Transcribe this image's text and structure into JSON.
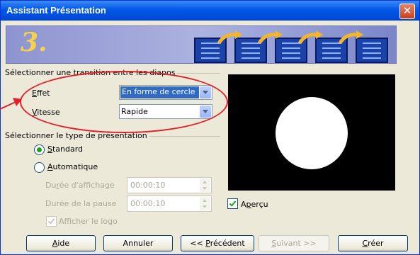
{
  "window": {
    "title": "Assistant Présentation",
    "close_glyph": "✕"
  },
  "banner": {
    "step_number": "3."
  },
  "transition_group": {
    "title": "Sélectionner une transition entre les diapos",
    "effect": {
      "label_first": "E",
      "label_rest": "ffet",
      "value": "En forme de cercle"
    },
    "speed": {
      "label_first": "V",
      "label_rest": "itesse",
      "value": "Rapide"
    }
  },
  "type_group": {
    "title": "Sélectionner le type de présentation",
    "standard": {
      "label_first": "S",
      "label_rest": "tandard",
      "selected": true
    },
    "automatic": {
      "label_first": "A",
      "label_rest": "utomatique",
      "selected": false
    },
    "display_duration": {
      "label_pre": "Du",
      "label_u": "r",
      "label_post": "ée d'affichage",
      "value": "00:00:10"
    },
    "pause_duration": {
      "label": "Durée de la pause",
      "value": "00:00:10"
    },
    "show_logo": {
      "label": "Afficher le logo",
      "checked": true
    }
  },
  "preview": {
    "label_first": "A",
    "label_u": "p",
    "label_rest": "erçu",
    "checked": true
  },
  "buttons": {
    "help": {
      "u": "A",
      "rest": "ide"
    },
    "cancel": "Annuler",
    "previous": {
      "pre": "<< ",
      "u": "P",
      "rest": "récédent"
    },
    "next": {
      "u": "S",
      "rest": "uivant >>"
    },
    "create": {
      "u": "C",
      "rest": "réer"
    }
  }
}
